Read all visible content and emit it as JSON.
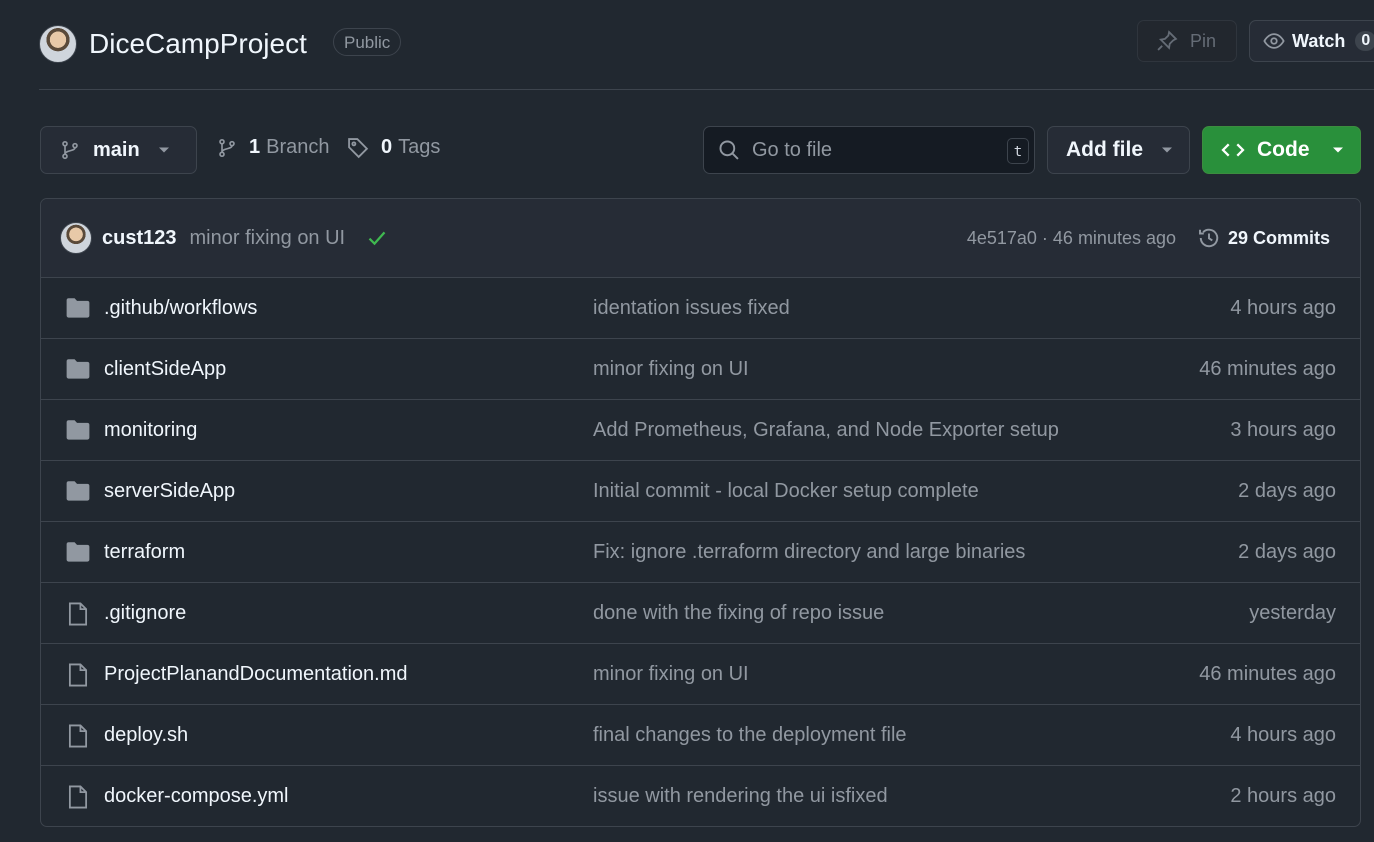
{
  "repo": {
    "name": "DiceCampProject",
    "visibility": "Public",
    "pin_label": "Pin",
    "watch_label": "Watch",
    "watch_count": "0"
  },
  "toolbar": {
    "branch_name": "main",
    "branches_count": "1",
    "branches_label": "Branch",
    "tags_count": "0",
    "tags_label": "Tags",
    "search_placeholder": "Go to file",
    "search_shortcut": "t",
    "add_file_label": "Add file",
    "code_label": "Code"
  },
  "latest_commit": {
    "author": "cust123",
    "message": "minor fixing on UI",
    "hash_time": "4e517a0 · 46 minutes ago",
    "commits_label": "29 Commits"
  },
  "files": [
    {
      "type": "folder",
      "name": ".github/workflows",
      "commit": "identation issues fixed",
      "time": "4 hours ago"
    },
    {
      "type": "folder",
      "name": "clientSideApp",
      "commit": "minor fixing on UI",
      "time": "46 minutes ago"
    },
    {
      "type": "folder",
      "name": "monitoring",
      "commit": "Add Prometheus, Grafana, and Node Exporter setup",
      "time": "3 hours ago"
    },
    {
      "type": "folder",
      "name": "serverSideApp",
      "commit": "Initial commit - local Docker setup complete",
      "time": "2 days ago"
    },
    {
      "type": "folder",
      "name": "terraform",
      "commit": "Fix: ignore .terraform directory and large binaries",
      "time": "2 days ago"
    },
    {
      "type": "file",
      "name": ".gitignore",
      "commit": "done with the fixing of repo issue",
      "time": "yesterday"
    },
    {
      "type": "file",
      "name": "ProjectPlanandDocumentation.md",
      "commit": "minor fixing on UI",
      "time": "46 minutes ago"
    },
    {
      "type": "file",
      "name": "deploy.sh",
      "commit": "final changes to the deployment file",
      "time": "4 hours ago"
    },
    {
      "type": "file",
      "name": "docker-compose.yml",
      "commit": "issue with rendering the ui isfixed",
      "time": "2 hours ago"
    }
  ],
  "colors": {
    "background": "#212830",
    "border": "#3d444d",
    "code_button": "#29903b",
    "check": "#3fb950",
    "folder_icon": "#9198a1"
  }
}
